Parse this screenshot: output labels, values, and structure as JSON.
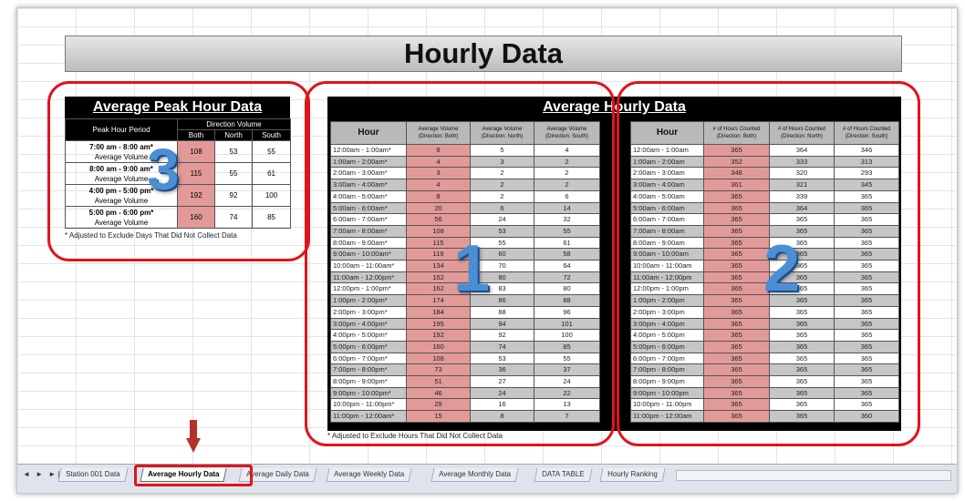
{
  "title": "Hourly Data",
  "peak": {
    "heading": "Average Peak Hour Data",
    "col_period": "Peak Hour Period",
    "col_group": "Direction Volume",
    "subcols": [
      "Both",
      "North",
      "South"
    ],
    "rows": [
      {
        "period": "7:00 am - 8:00 am*",
        "sub": "Average Volume",
        "both": "108",
        "north": "53",
        "south": "55"
      },
      {
        "period": "8:00 am - 9:00 am*",
        "sub": "Average Volume",
        "both": "115",
        "north": "55",
        "south": "61"
      },
      {
        "period": "4:00 pm - 5:00 pm*",
        "sub": "Average Volume",
        "both": "192",
        "north": "92",
        "south": "100"
      },
      {
        "period": "5:00 pm - 6:00 pm*",
        "sub": "Average Volume",
        "both": "160",
        "north": "74",
        "south": "85"
      }
    ],
    "note": "* Adjusted to Exclude Days That Did Not Collect Data"
  },
  "hourly": {
    "heading": "Average Hourly Data",
    "vol_headers": {
      "hour": "Hour",
      "both": "Average Volume (Direction: Both)",
      "north": "Average Volume (Direction: North)",
      "south": "Average Volume (Direction: South)"
    },
    "cnt_headers": {
      "hour": "Hour",
      "both": "# of Hours Counted (Direction: Both)",
      "north": "# of Hours Counted (Direction: North)",
      "south": "# of Hours Counted (Direction: South)"
    },
    "volume_rows": [
      [
        "12:00am - 1:00am*",
        "8",
        "5",
        "4"
      ],
      [
        "1:00am - 2:00am*",
        "4",
        "3",
        "2"
      ],
      [
        "2:00am - 3:00am*",
        "3",
        "2",
        "2"
      ],
      [
        "3:00am - 4:00am*",
        "4",
        "2",
        "2"
      ],
      [
        "4:00am - 5:00am*",
        "8",
        "2",
        "6"
      ],
      [
        "5:00am - 6:00am*",
        "20",
        "6",
        "14"
      ],
      [
        "6:00am - 7:00am*",
        "56",
        "24",
        "32"
      ],
      [
        "7:00am - 8:00am*",
        "108",
        "53",
        "55"
      ],
      [
        "8:00am - 9:00am*",
        "115",
        "55",
        "61"
      ],
      [
        "9:00am - 10:00am*",
        "119",
        "60",
        "58"
      ],
      [
        "10:00am - 11:00am*",
        "134",
        "70",
        "64"
      ],
      [
        "11:00am - 12:00pm*",
        "152",
        "80",
        "72"
      ],
      [
        "12:00pm - 1:00pm*",
        "162",
        "83",
        "80"
      ],
      [
        "1:00pm - 2:00pm*",
        "174",
        "86",
        "88"
      ],
      [
        "2:00pm - 3:00pm*",
        "184",
        "88",
        "96"
      ],
      [
        "3:00pm - 4:00pm*",
        "195",
        "94",
        "101"
      ],
      [
        "4:00pm - 5:00pm*",
        "192",
        "92",
        "100"
      ],
      [
        "5:00pm - 6:00pm*",
        "160",
        "74",
        "85"
      ],
      [
        "6:00pm - 7:00pm*",
        "108",
        "53",
        "55"
      ],
      [
        "7:00pm - 8:00pm*",
        "73",
        "36",
        "37"
      ],
      [
        "8:00pm - 9:00pm*",
        "51",
        "27",
        "24"
      ],
      [
        "9:00pm - 10:00pm*",
        "46",
        "24",
        "22"
      ],
      [
        "10:00pm - 11:00pm*",
        "29",
        "16",
        "13"
      ],
      [
        "11:00pm - 12:00am*",
        "15",
        "8",
        "7"
      ]
    ],
    "count_rows": [
      [
        "12:00am - 1:00am",
        "365",
        "364",
        "346"
      ],
      [
        "1:00am - 2:00am",
        "352",
        "333",
        "313"
      ],
      [
        "2:00am - 3:00am",
        "348",
        "320",
        "293"
      ],
      [
        "3:00am - 4:00am",
        "361",
        "321",
        "345"
      ],
      [
        "4:00am - 5:00am",
        "365",
        "339",
        "365"
      ],
      [
        "5:00am - 6:00am",
        "365",
        "364",
        "365"
      ],
      [
        "6:00am - 7:00am",
        "365",
        "365",
        "365"
      ],
      [
        "7:00am - 8:00am",
        "365",
        "365",
        "365"
      ],
      [
        "8:00am - 9:00am",
        "365",
        "365",
        "365"
      ],
      [
        "9:00am - 10:00am",
        "365",
        "365",
        "365"
      ],
      [
        "10:00am - 11:00am",
        "365",
        "365",
        "365"
      ],
      [
        "11:00am - 12:00pm",
        "365",
        "365",
        "365"
      ],
      [
        "12:00pm - 1:00pm",
        "365",
        "365",
        "365"
      ],
      [
        "1:00pm - 2:00pm",
        "365",
        "365",
        "365"
      ],
      [
        "2:00pm - 3:00pm",
        "365",
        "365",
        "365"
      ],
      [
        "3:00pm - 4:00pm",
        "365",
        "365",
        "365"
      ],
      [
        "4:00pm - 5:00pm",
        "365",
        "365",
        "365"
      ],
      [
        "5:00pm - 6:00pm",
        "365",
        "365",
        "365"
      ],
      [
        "6:00pm - 7:00pm",
        "365",
        "365",
        "365"
      ],
      [
        "7:00pm - 8:00pm",
        "365",
        "365",
        "365"
      ],
      [
        "8:00pm - 9:00pm",
        "365",
        "365",
        "365"
      ],
      [
        "9:00pm - 10:00pm",
        "365",
        "365",
        "365"
      ],
      [
        "10:00pm - 11:00pm",
        "365",
        "365",
        "365"
      ],
      [
        "11:00pm - 12:00am",
        "365",
        "365",
        "360"
      ]
    ],
    "note": "* Adjusted to Exclude Hours That Did Not Collect Data"
  },
  "callouts": [
    "1",
    "2",
    "3"
  ],
  "tabs": [
    "Station 001 Data",
    "Average Hourly Data",
    "Average Daily Data",
    "Average Weekly Data",
    "Average Monthly Data",
    "DATA TABLE",
    "Hourly Ranking"
  ],
  "active_tab": "Average Hourly Data",
  "nav_arrows": "◄ ► ►|",
  "colors": {
    "highlight_red": "#e0141c",
    "pink_cell": "#e29a98",
    "callout_blue": "#4a8fd4"
  }
}
